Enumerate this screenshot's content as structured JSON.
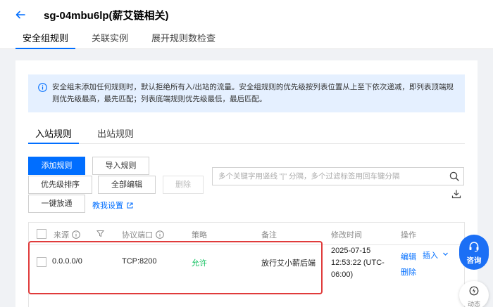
{
  "header": {
    "title": "sg-04mbu6lp(薪艾链相关)",
    "tabs": [
      {
        "label": "安全组规则",
        "active": true
      },
      {
        "label": "关联实例",
        "active": false
      },
      {
        "label": "展开规则数检查",
        "active": false
      }
    ]
  },
  "notice": {
    "text": "安全组未添加任何规则时，默认拒绝所有入/出站的流量。安全组规则的优先级按列表位置从上至下依次递减，即列表顶端规则优先级最高，最先匹配；列表底端规则优先级最低，最后匹配。"
  },
  "rule_tabs": [
    {
      "label": "入站规则",
      "active": true
    },
    {
      "label": "出站规则",
      "active": false
    }
  ],
  "toolbar": {
    "add_rule": "添加规则",
    "import_rules": "导入规则",
    "sort_priority": "优先级排序",
    "edit_all": "全部编辑",
    "delete": "删除",
    "one_click_open": "一键放通",
    "help_link": "教我设置"
  },
  "search": {
    "placeholder": "多个关键字用竖线 \"|\" 分隔，多个过滤标签用回车键分隔"
  },
  "table": {
    "columns": {
      "source": "来源",
      "port": "协议端口",
      "policy": "策略",
      "note": "备注",
      "modified": "修改时间",
      "ops": "操作"
    },
    "rows": [
      {
        "source": "0.0.0.0/0",
        "port": "TCP:8200",
        "policy": "允许",
        "note": "放行艾小薪后端",
        "modified_line1": "2025-07-15",
        "modified_line2": "12:53:22 (UTC-",
        "modified_line3": "06:00)",
        "edit": "编辑",
        "insert": "插入",
        "delete": "删除"
      }
    ]
  },
  "floating": {
    "consult": "咨询",
    "dynamic": "动态"
  },
  "colors": {
    "primary": "#006eff",
    "allow": "#0abf5b",
    "highlight": "#e03b3b",
    "notice_bg": "#e5f0ff"
  }
}
